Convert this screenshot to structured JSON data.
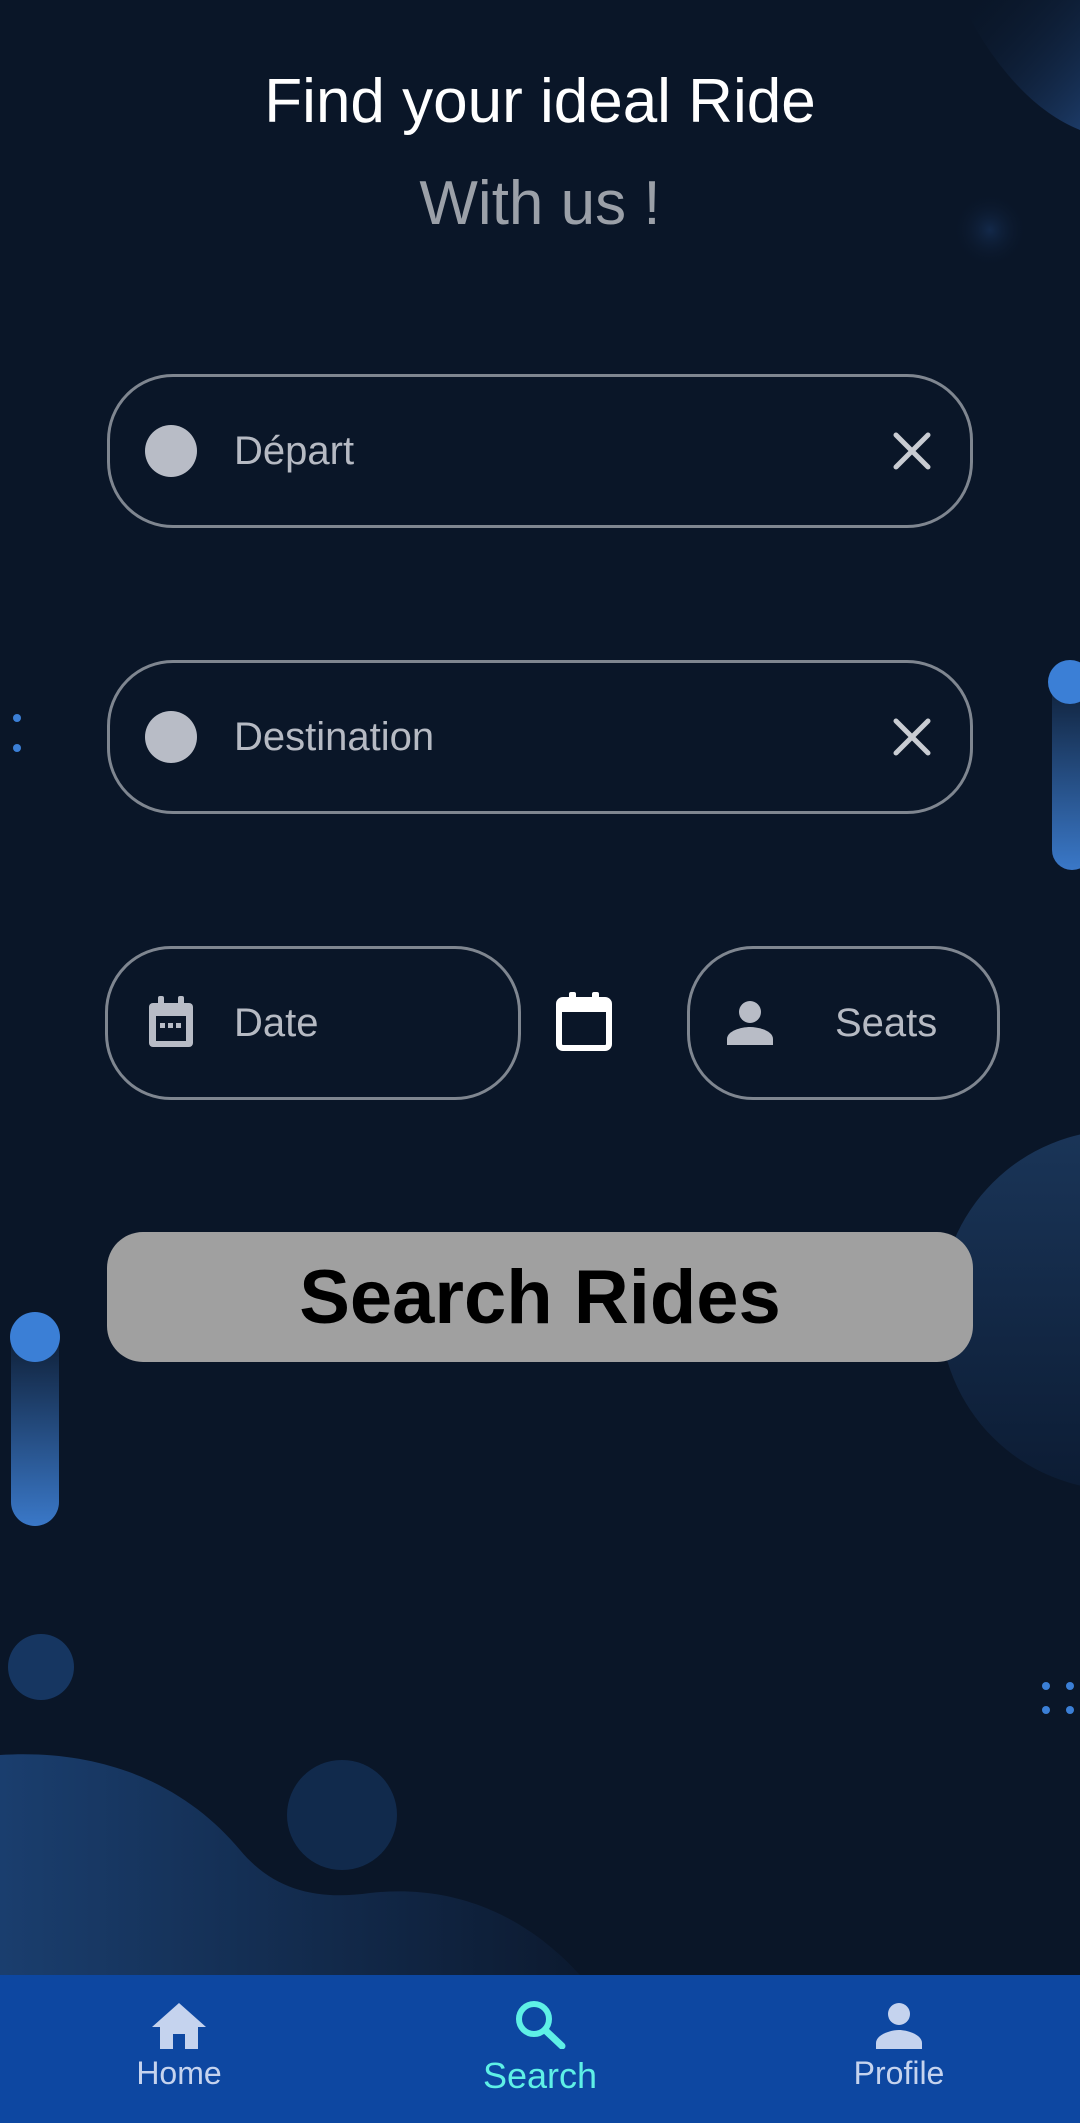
{
  "header": {
    "title": "Find your ideal Ride",
    "subtitle": "With us !"
  },
  "form": {
    "departure_label": "Départ",
    "destination_label": "Destination",
    "date_label": "Date",
    "seats_label": "Seats"
  },
  "search_button_label": "Search Rides",
  "bottom_nav": {
    "items": [
      {
        "label": "Home",
        "icon": "home-icon",
        "active": false
      },
      {
        "label": "Search",
        "icon": "search-icon",
        "active": true
      },
      {
        "label": "Profile",
        "icon": "person-icon",
        "active": false
      }
    ]
  },
  "colors": {
    "background": "#0a1628",
    "field_border": "#7f8690",
    "button": "#a0a0a0",
    "nav_bar": "#0d47a1",
    "nav_active": "#5ef0e6",
    "accent_blue": "#3b7fd6"
  }
}
